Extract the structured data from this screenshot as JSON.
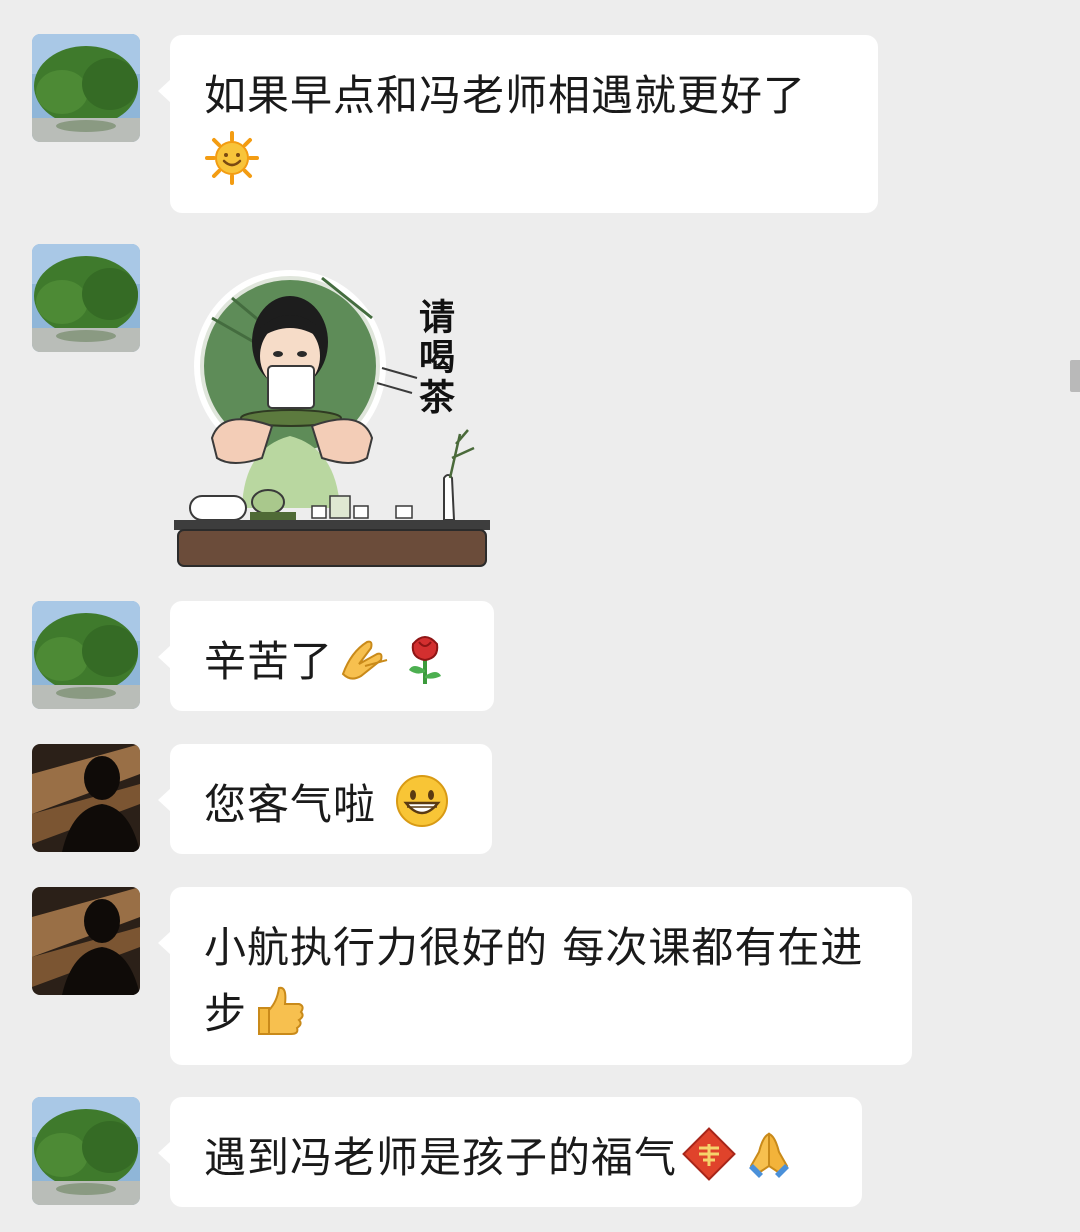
{
  "messages": [
    {
      "sender": "parent",
      "type": "text",
      "text": "如果早点和冯老师相遇就更好了",
      "emoji": "sun-face"
    },
    {
      "sender": "parent",
      "type": "sticker",
      "sticker_text": "请喝茶"
    },
    {
      "sender": "parent",
      "type": "text",
      "text": "辛苦了",
      "emoji": [
        "handshake-hand",
        "rose"
      ]
    },
    {
      "sender": "teacher",
      "type": "text",
      "text": "您客气啦",
      "emoji": "grinning-face"
    },
    {
      "sender": "teacher",
      "type": "text",
      "text": "小航执行力很好的 每次课都有在进步",
      "emoji": "thumbs-up"
    },
    {
      "sender": "parent",
      "type": "text",
      "text": "遇到冯老师是孩子的福气",
      "emoji": [
        "fu-blessing",
        "folded-hands"
      ]
    }
  ],
  "colors": {
    "background": "#ededed",
    "bubble": "#ffffff",
    "text": "#1a1a1a"
  }
}
